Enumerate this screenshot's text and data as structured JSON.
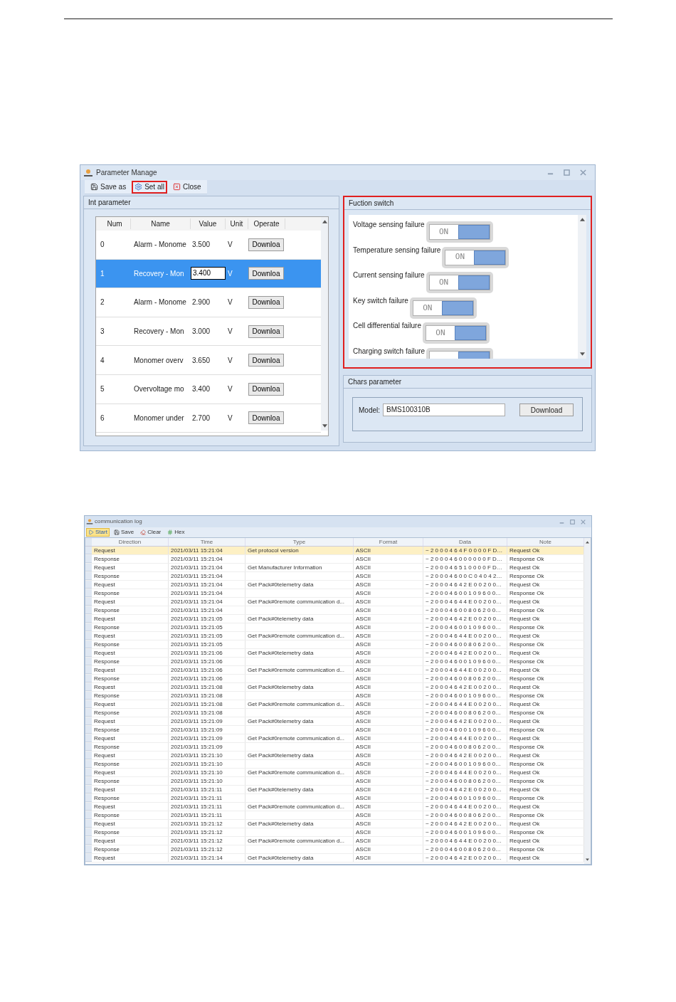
{
  "parameter_window": {
    "title": "Parameter Manage",
    "toolbar": [
      {
        "kind": "save",
        "label": "Save as",
        "highlighted": false
      },
      {
        "kind": "settings",
        "label": "Set all",
        "highlighted": true
      },
      {
        "kind": "close",
        "label": "Close",
        "highlighted": false
      }
    ],
    "int_parameter": {
      "title": "Int parameter",
      "columns": [
        "Num",
        "Name",
        "Value",
        "Unit",
        "Operate"
      ],
      "rows": [
        {
          "num": "0",
          "name": "Alarm - Monome",
          "value": "3.500",
          "unit": "V",
          "operate": "Downloa",
          "selected": false,
          "editing": false
        },
        {
          "num": "1",
          "name": "Recovery - Mon",
          "value": "3.400",
          "unit": "V",
          "operate": "Downloa",
          "selected": true,
          "editing": true
        },
        {
          "num": "2",
          "name": "Alarm - Monome",
          "value": "2.900",
          "unit": "V",
          "operate": "Downloa",
          "selected": false,
          "editing": false
        },
        {
          "num": "3",
          "name": "Recovery - Mon",
          "value": "3.000",
          "unit": "V",
          "operate": "Downloa",
          "selected": false,
          "editing": false
        },
        {
          "num": "4",
          "name": "Monomer overv",
          "value": "3.650",
          "unit": "V",
          "operate": "Downloa",
          "selected": false,
          "editing": false
        },
        {
          "num": "5",
          "name": "Overvoltage mo",
          "value": "3.400",
          "unit": "V",
          "operate": "Downloa",
          "selected": false,
          "editing": false
        },
        {
          "num": "6",
          "name": "Monomer under",
          "value": "2.700",
          "unit": "V",
          "operate": "Downloa",
          "selected": false,
          "editing": false
        }
      ]
    },
    "function_switch": {
      "title": "Fuction switch",
      "highlighted": true,
      "items": [
        {
          "label": "Voltage sensing failure",
          "on": true,
          "state_label": "ON"
        },
        {
          "label": "Temperature sensing failure",
          "on": true,
          "state_label": "ON"
        },
        {
          "label": "Current sensing failure",
          "on": true,
          "state_label": "ON"
        },
        {
          "label": "Key switch failure",
          "on": true,
          "state_label": "ON"
        },
        {
          "label": "Cell differential failure",
          "on": true,
          "state_label": "ON"
        },
        {
          "label": "Charging switch failure",
          "on": true
        }
      ]
    },
    "chars_parameter": {
      "title": "Chars parameter",
      "model_label": "Model:",
      "model_value": "BMS100310B",
      "button": "Download"
    }
  },
  "log_window": {
    "title": "communication log",
    "toolbar": [
      {
        "kind": "start",
        "label": "Start",
        "active": true
      },
      {
        "kind": "save",
        "label": "Save",
        "active": false
      },
      {
        "kind": "clear",
        "label": "Clear",
        "active": false
      },
      {
        "kind": "hex",
        "label": "Hex",
        "active": false
      }
    ],
    "columns": [
      "Direction",
      "Time",
      "Type",
      "Format",
      "Data",
      "Note"
    ],
    "rows": [
      {
        "direction": "Request",
        "time": "2021/03/11 15:21:04",
        "type": "Get protocol version",
        "format": "ASCII",
        "data": "~ 2 0 0 0 4 6 4 F 0 0 0 0 F D…",
        "note": "Request Ok",
        "selected": true
      },
      {
        "direction": "Response",
        "time": "2021/03/11 15:21:04",
        "format": "ASCII",
        "data": "~ 2 0 0 0 4 6 0 0 0 0 0 0 F D…",
        "note": "Response Ok",
        "selected": false
      },
      {
        "direction": "Request",
        "time": "2021/03/11 15:21:04",
        "type": "Get Manufacturer Information",
        "format": "ASCII",
        "data": "~ 2 0 0 0 4 6 5 1 0 0 0 0 F D…",
        "note": "Request Ok",
        "selected": false
      },
      {
        "direction": "Response",
        "time": "2021/03/11 15:21:04",
        "format": "ASCII",
        "data": "~ 2 0 0 0 4 6 0 0 C 0 4 0 4 2…",
        "note": "Response Ok",
        "selected": false
      },
      {
        "direction": "Request",
        "time": "2021/03/11 15:21:04",
        "type": "Get Pack#0telemetry data",
        "format": "ASCII",
        "data": "~ 2 0 0 0 4 6 4 2 E 0 0 2 0 0…",
        "note": "Request Ok",
        "selected": false
      },
      {
        "direction": "Response",
        "time": "2021/03/11 15:21:04",
        "format": "ASCII",
        "data": "~ 2 0 0 0 4 6 0 0 1 0 9 6 0 0…",
        "note": "Response Ok",
        "selected": false
      },
      {
        "direction": "Request",
        "time": "2021/03/11 15:21:04",
        "type": "Get Pack#0remote communication d...",
        "format": "ASCII",
        "data": "~ 2 0 0 0 4 6 4 4 E 0 0 2 0 0…",
        "note": "Request Ok",
        "selected": false
      },
      {
        "direction": "Response",
        "time": "2021/03/11 15:21:04",
        "format": "ASCII",
        "data": "~ 2 0 0 0 4 6 0 0 8 0 6 2 0 0…",
        "note": "Response Ok",
        "selected": false
      },
      {
        "direction": "Request",
        "time": "2021/03/11 15:21:05",
        "type": "Get Pack#0telemetry data",
        "format": "ASCII",
        "data": "~ 2 0 0 0 4 6 4 2 E 0 0 2 0 0…",
        "note": "Request Ok",
        "selected": false
      },
      {
        "direction": "Response",
        "time": "2021/03/11 15:21:05",
        "format": "ASCII",
        "data": "~ 2 0 0 0 4 6 0 0 1 0 9 6 0 0…",
        "note": "Response Ok",
        "selected": false
      },
      {
        "direction": "Request",
        "time": "2021/03/11 15:21:05",
        "type": "Get Pack#0remote communication d...",
        "format": "ASCII",
        "data": "~ 2 0 0 0 4 6 4 4 E 0 0 2 0 0…",
        "note": "Request Ok",
        "selected": false
      },
      {
        "direction": "Response",
        "time": "2021/03/11 15:21:05",
        "format": "ASCII",
        "data": "~ 2 0 0 0 4 6 0 0 8 0 6 2 0 0…",
        "note": "Response Ok",
        "selected": false
      },
      {
        "direction": "Request",
        "time": "2021/03/11 15:21:06",
        "type": "Get Pack#0telemetry data",
        "format": "ASCII",
        "data": "~ 2 0 0 0 4 6 4 2 E 0 0 2 0 0…",
        "note": "Request Ok",
        "selected": false
      },
      {
        "direction": "Response",
        "time": "2021/03/11 15:21:06",
        "format": "ASCII",
        "data": "~ 2 0 0 0 4 6 0 0 1 0 9 6 0 0…",
        "note": "Response Ok",
        "selected": false
      },
      {
        "direction": "Request",
        "time": "2021/03/11 15:21:06",
        "type": "Get Pack#0remote communication d...",
        "format": "ASCII",
        "data": "~ 2 0 0 0 4 6 4 4 E 0 0 2 0 0…",
        "note": "Request Ok",
        "selected": false
      },
      {
        "direction": "Response",
        "time": "2021/03/11 15:21:06",
        "format": "ASCII",
        "data": "~ 2 0 0 0 4 6 0 0 8 0 6 2 0 0…",
        "note": "Response Ok",
        "selected": false
      },
      {
        "direction": "Request",
        "time": "2021/03/11 15:21:08",
        "type": "Get Pack#0telemetry data",
        "format": "ASCII",
        "data": "~ 2 0 0 0 4 6 4 2 E 0 0 2 0 0…",
        "note": "Request Ok",
        "selected": false
      },
      {
        "direction": "Response",
        "time": "2021/03/11 15:21:08",
        "format": "ASCII",
        "data": "~ 2 0 0 0 4 6 0 0 1 0 9 6 0 0…",
        "note": "Response Ok",
        "selected": false
      },
      {
        "direction": "Request",
        "time": "2021/03/11 15:21:08",
        "type": "Get Pack#0remote communication d...",
        "format": "ASCII",
        "data": "~ 2 0 0 0 4 6 4 4 E 0 0 2 0 0…",
        "note": "Request Ok",
        "selected": false
      },
      {
        "direction": "Response",
        "time": "2021/03/11 15:21:08",
        "format": "ASCII",
        "data": "~ 2 0 0 0 4 6 0 0 8 0 6 2 0 0…",
        "note": "Response Ok",
        "selected": false
      },
      {
        "direction": "Request",
        "time": "2021/03/11 15:21:09",
        "type": "Get Pack#0telemetry data",
        "format": "ASCII",
        "data": "~ 2 0 0 0 4 6 4 2 E 0 0 2 0 0…",
        "note": "Request Ok",
        "selected": false
      },
      {
        "direction": "Response",
        "time": "2021/03/11 15:21:09",
        "format": "ASCII",
        "data": "~ 2 0 0 0 4 6 0 0 1 0 9 6 0 0…",
        "note": "Response Ok",
        "selected": false
      },
      {
        "direction": "Request",
        "time": "2021/03/11 15:21:09",
        "type": "Get Pack#0remote communication d...",
        "format": "ASCII",
        "data": "~ 2 0 0 0 4 6 4 4 E 0 0 2 0 0…",
        "note": "Request Ok",
        "selected": false
      },
      {
        "direction": "Response",
        "time": "2021/03/11 15:21:09",
        "format": "ASCII",
        "data": "~ 2 0 0 0 4 6 0 0 8 0 6 2 0 0…",
        "note": "Response Ok",
        "selected": false
      },
      {
        "direction": "Request",
        "time": "2021/03/11 15:21:10",
        "type": "Get Pack#0telemetry data",
        "format": "ASCII",
        "data": "~ 2 0 0 0 4 6 4 2 E 0 0 2 0 0…",
        "note": "Request Ok",
        "selected": false
      },
      {
        "direction": "Response",
        "time": "2021/03/11 15:21:10",
        "format": "ASCII",
        "data": "~ 2 0 0 0 4 6 0 0 1 0 9 6 0 0…",
        "note": "Response Ok",
        "selected": false
      },
      {
        "direction": "Request",
        "time": "2021/03/11 15:21:10",
        "type": "Get Pack#0remote communication d...",
        "format": "ASCII",
        "data": "~ 2 0 0 0 4 6 4 4 E 0 0 2 0 0…",
        "note": "Request Ok",
        "selected": false
      },
      {
        "direction": "Response",
        "time": "2021/03/11 15:21:10",
        "format": "ASCII",
        "data": "~ 2 0 0 0 4 6 0 0 8 0 6 2 0 0…",
        "note": "Response Ok",
        "selected": false
      },
      {
        "direction": "Request",
        "time": "2021/03/11 15:21:11",
        "type": "Get Pack#0telemetry data",
        "format": "ASCII",
        "data": "~ 2 0 0 0 4 6 4 2 E 0 0 2 0 0…",
        "note": "Request Ok",
        "selected": false
      },
      {
        "direction": "Response",
        "time": "2021/03/11 15:21:11",
        "format": "ASCII",
        "data": "~ 2 0 0 0 4 6 0 0 1 0 9 6 0 0…",
        "note": "Response Ok",
        "selected": false
      },
      {
        "direction": "Request",
        "time": "2021/03/11 15:21:11",
        "type": "Get Pack#0remote communication d...",
        "format": "ASCII",
        "data": "~ 2 0 0 0 4 6 4 4 E 0 0 2 0 0…",
        "note": "Request Ok",
        "selected": false
      },
      {
        "direction": "Response",
        "time": "2021/03/11 15:21:11",
        "format": "ASCII",
        "data": "~ 2 0 0 0 4 6 0 0 8 0 6 2 0 0…",
        "note": "Response Ok",
        "selected": false
      },
      {
        "direction": "Request",
        "time": "2021/03/11 15:21:12",
        "type": "Get Pack#0telemetry data",
        "format": "ASCII",
        "data": "~ 2 0 0 0 4 6 4 2 E 0 0 2 0 0…",
        "note": "Request Ok",
        "selected": false
      },
      {
        "direction": "Response",
        "time": "2021/03/11 15:21:12",
        "format": "ASCII",
        "data": "~ 2 0 0 0 4 6 0 0 1 0 9 6 0 0…",
        "note": "Response Ok",
        "selected": false
      },
      {
        "direction": "Request",
        "time": "2021/03/11 15:21:12",
        "type": "Get Pack#0remote communication d...",
        "format": "ASCII",
        "data": "~ 2 0 0 0 4 6 4 4 E 0 0 2 0 0…",
        "note": "Request Ok",
        "selected": false
      },
      {
        "direction": "Response",
        "time": "2021/03/11 15:21:12",
        "format": "ASCII",
        "data": "~ 2 0 0 0 4 6 0 0 8 0 6 2 0 0…",
        "note": "Response Ok",
        "selected": false
      },
      {
        "direction": "Request",
        "time": "2021/03/11 15:21:14",
        "type": "Get Pack#0telemetry data",
        "format": "ASCII",
        "data": "~ 2 0 0 0 4 6 4 2 E 0 0 2 0 0…",
        "note": "Request Ok",
        "selected": false
      }
    ]
  }
}
